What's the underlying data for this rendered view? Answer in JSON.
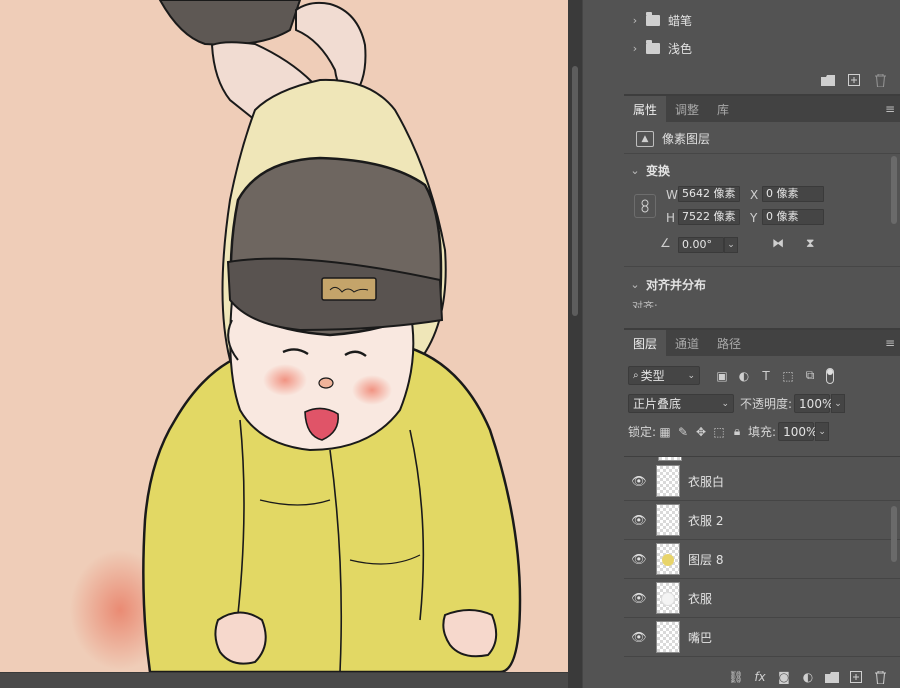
{
  "brushes_panel": {
    "folders": [
      {
        "label": "蜡笔"
      },
      {
        "label": "浅色"
      }
    ],
    "tools": [
      "new-folder-icon",
      "new-item-icon",
      "trash-icon"
    ]
  },
  "properties": {
    "tabs": [
      {
        "label": "属性",
        "active": true
      },
      {
        "label": "调整",
        "active": false
      },
      {
        "label": "库",
        "active": false
      }
    ],
    "layer_type": "像素图层",
    "transform": {
      "title": "变换",
      "w_label": "W",
      "w_value": "5642 像素",
      "x_label": "X",
      "x_value": "0 像素",
      "h_label": "H",
      "h_value": "7522 像素",
      "y_label": "Y",
      "y_value": "0 像素",
      "angle_value": "0.00°"
    },
    "align": {
      "title": "对齐并分布",
      "cut_text": "对齐:"
    }
  },
  "layers": {
    "tabs": [
      {
        "label": "图层",
        "active": true
      },
      {
        "label": "通道",
        "active": false
      },
      {
        "label": "路径",
        "active": false
      }
    ],
    "filter_kind": "类型",
    "blend_mode": "正片叠底",
    "opacity_label": "不透明度:",
    "opacity_value": "100%",
    "lock_label": "锁定:",
    "fill_label": "填充:",
    "fill_value": "100%",
    "items": [
      {
        "name": "衣服白",
        "thumb": "empty"
      },
      {
        "name": "衣服 2",
        "thumb": "empty"
      },
      {
        "name": "图层 8",
        "thumb": "yellow"
      },
      {
        "name": "衣服",
        "thumb": "white"
      },
      {
        "name": "嘴巴",
        "thumb": "empty"
      }
    ]
  },
  "colors": {
    "panel_bg": "#535353",
    "tab_bar_bg": "#424242",
    "canvas_paper": "#efcdb8",
    "suit_yellow": "#e2d864",
    "hat_gray": "#6e6660"
  }
}
